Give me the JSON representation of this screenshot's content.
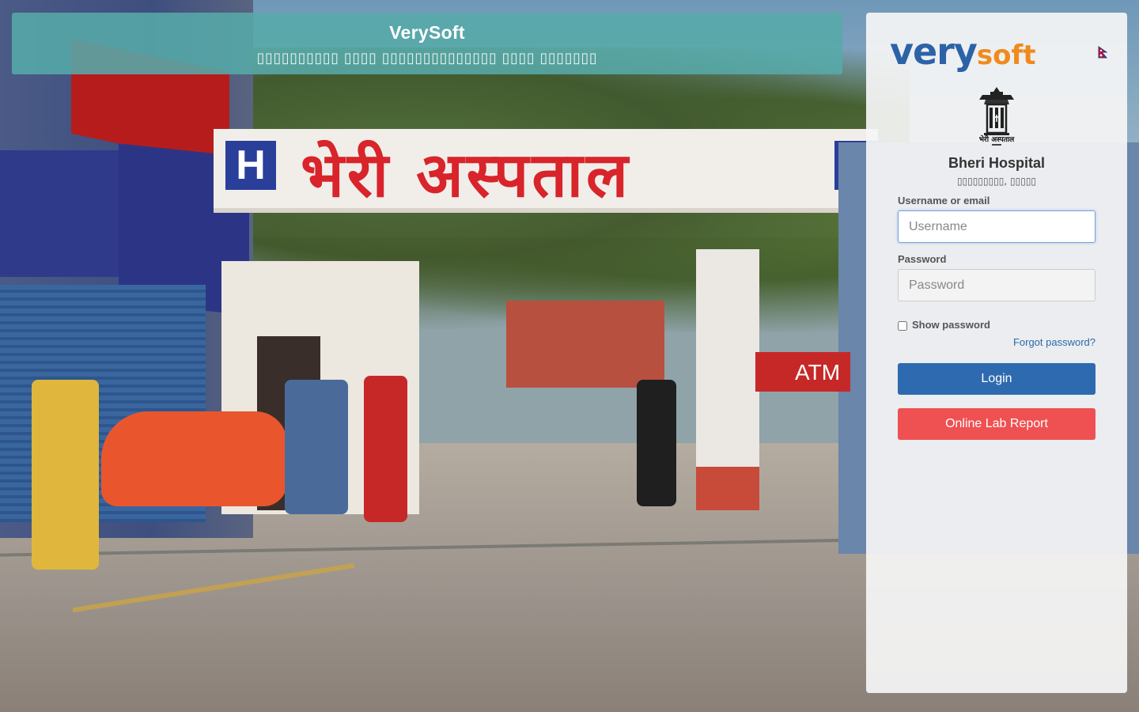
{
  "banner": {
    "title": "VerySoft",
    "subtitle": "▯▯▯▯▯▯▯▯▯▯ ▯▯▯▯ ▯▯▯▯▯▯▯▯▯▯▯▯▯▯ ▯▯▯▯ ▯▯▯▯▯▯▯"
  },
  "brand": {
    "logo_very": "very",
    "logo_soft": "soft"
  },
  "background": {
    "gate_sign_text": "भेरी अस्पताल",
    "gate_h_letter": "H",
    "atm_text": "ATM"
  },
  "hospital": {
    "emblem_caption": "भेरी अस्पताल",
    "name": "Bheri Hospital",
    "location": "▯▯▯▯▯▯▯▯▯, ▯▯▯▯▯"
  },
  "login": {
    "username_label": "Username or email",
    "username_placeholder": "Username",
    "username_value": "",
    "password_label": "Password",
    "password_placeholder": "Password",
    "password_value": "",
    "show_password_label": "Show password",
    "show_password_checked": false,
    "forgot_password": "Forgot password?",
    "login_button": "Login",
    "lab_report_button": "Online Lab Report"
  },
  "colors": {
    "banner_bg": "#56aaa8",
    "login_button": "#2e6aaf",
    "lab_button": "#ef5052",
    "link": "#2c6aa8",
    "logo_blue": "#2c63a8",
    "logo_orange": "#f08a1c"
  },
  "icons": {
    "flag": "nepal-flag-icon",
    "emblem": "hospital-emblem-icon"
  }
}
